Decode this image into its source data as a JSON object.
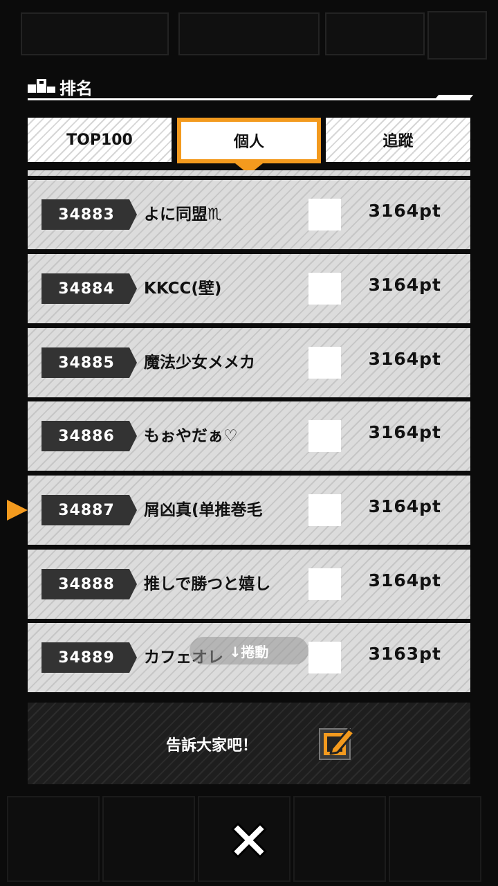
{
  "header": {
    "title": "排名",
    "icon": "podium-icon"
  },
  "tabs": [
    {
      "label": "TOP100",
      "active": false
    },
    {
      "label": "個人",
      "active": true
    },
    {
      "label": "追蹤",
      "active": false
    }
  ],
  "rows": [
    {
      "rank": "34883",
      "name": "よに同盟♏",
      "points": "3164pt"
    },
    {
      "rank": "34884",
      "name": "KKCC(壁)",
      "points": "3164pt"
    },
    {
      "rank": "34885",
      "name": "魔法少女メメカ",
      "points": "3164pt"
    },
    {
      "rank": "34886",
      "name": "もぉやだぁ♡",
      "points": "3164pt"
    },
    {
      "rank": "34887",
      "name": "屑凶真(单推巻毛",
      "points": "3164pt",
      "is_self": true
    },
    {
      "rank": "34888",
      "name": "推しで勝つと嬉し",
      "points": "3164pt"
    },
    {
      "rank": "34889",
      "name": "カフェオレ",
      "points": "3163pt"
    }
  ],
  "scroll_hint": "↓捲動",
  "share": {
    "label": "告訴大家吧！",
    "icon": "edit-icon"
  },
  "close_icon": "close-icon",
  "colors": {
    "accent": "#f39a1e",
    "rank_bg": "#333333"
  }
}
